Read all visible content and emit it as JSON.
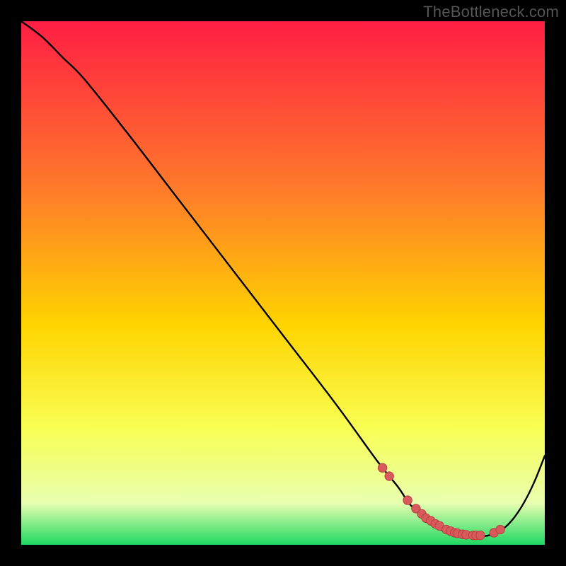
{
  "watermark": "TheBottleneck.com",
  "colors": {
    "page_bg": "#000000",
    "gradient_top": "#ff1e44",
    "gradient_upper_mid": "#ff7a2a",
    "gradient_mid": "#ffd400",
    "gradient_lower_mid": "#f8ff54",
    "gradient_pale": "#e8ffb0",
    "gradient_green": "#1fd862",
    "curve_stroke": "#000000",
    "dot_fill": "#d85a5a",
    "dot_stroke": "#b84040"
  },
  "chart_data": {
    "type": "line",
    "title": "",
    "xlabel": "",
    "ylabel": "",
    "xlim": [
      0,
      100
    ],
    "ylim": [
      0,
      100
    ],
    "grid": false,
    "legend": false,
    "series": [
      {
        "name": "bottleneck-curve",
        "x": [
          0,
          4,
          8,
          12,
          20,
          30,
          40,
          50,
          60,
          68,
          72,
          74,
          76,
          78,
          80,
          82,
          84,
          86,
          88,
          90,
          92,
          94,
          96,
          98,
          100
        ],
        "y": [
          100,
          97,
          93,
          89,
          79,
          66,
          53,
          40,
          27,
          16,
          11,
          8,
          6,
          4,
          3,
          2,
          1.8,
          1.6,
          1.6,
          2,
          3,
          5,
          8,
          12,
          17
        ]
      }
    ],
    "markers": {
      "name": "highlighted-points",
      "x": [
        69,
        70.3,
        73.8,
        75.4,
        76.5,
        77.3,
        78.2,
        79.1,
        79.9,
        81.2,
        82,
        82.8,
        83.3,
        84.3,
        85,
        86.3,
        86.9,
        87.7,
        90.3,
        91.5
      ],
      "y": [
        14.7,
        13.1,
        8.5,
        6.9,
        5.9,
        5.1,
        4.6,
        4.0,
        3.6,
        2.9,
        2.6,
        2.3,
        2.2,
        2.0,
        1.9,
        1.8,
        1.8,
        1.8,
        2.3,
        2.9
      ]
    }
  }
}
